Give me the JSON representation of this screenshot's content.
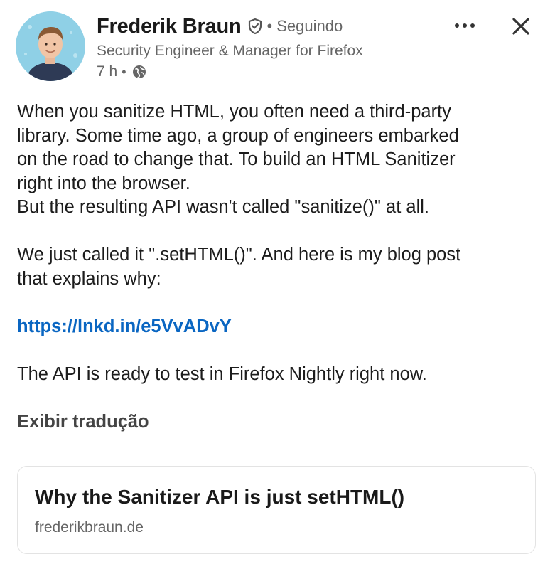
{
  "post": {
    "author": {
      "name": "Frederik Braun",
      "follow_status": "Seguindo",
      "separator": "•",
      "headline": "Security Engineer & Manager for Firefox",
      "time": "7 h",
      "time_separator": "•",
      "verified_icon": "verified-shield-icon",
      "visibility_icon": "globe-icon"
    },
    "actions": {
      "more_icon": "more-horizontal-icon",
      "close_icon": "close-icon"
    },
    "body": {
      "paragraph1_line1": "When you sanitize HTML, you often need a third-party",
      "paragraph1_line2": "library. Some time ago, a group of engineers embarked",
      "paragraph1_line3": "on the road to change that. To build an HTML Sanitizer",
      "paragraph1_line4": "right into the browser.",
      "paragraph1_line5": "But the resulting API wasn't called \"sanitize()\" at all.",
      "paragraph2_line1": "We just called it \".setHTML()\". And here is my blog post",
      "paragraph2_line2": "that explains why:",
      "link": "https://lnkd.in/e5VvADvY",
      "paragraph3": "The API is ready to test in Firefox Nightly right now."
    },
    "translate_label": "Exibir tradução",
    "link_card": {
      "title": "Why the Sanitizer API is just setHTML()",
      "domain": "frederikbraun.de"
    }
  },
  "colors": {
    "link": "#0a66c2",
    "secondary_text": "#666666",
    "primary_text": "#1c1c1c",
    "card_border": "#e3e3e3"
  }
}
